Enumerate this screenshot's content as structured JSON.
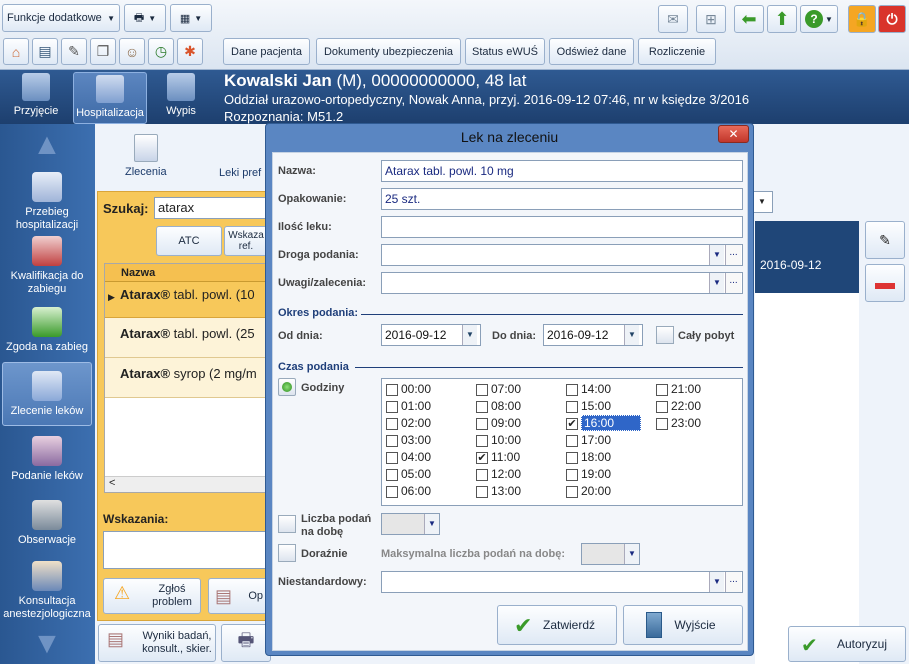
{
  "toolbar": {
    "extra_functions": "Funkcje dodatkowe",
    "buttons": [
      "Dane pacjenta",
      "Dokumenty ubezpieczenia",
      "Status eWUŚ",
      "Odśwież dane",
      "Rozliczenie"
    ]
  },
  "patient": {
    "name": "Kowalski Jan",
    "details": "(M), 00000000000, 48 lat",
    "line2": "Oddział urazowo-ortopedyczny, Nowak Anna, przyj. 2016-09-12 07:46, nr w księdze 3/2016",
    "line3": "Rozpoznania: M51.2"
  },
  "tabs": {
    "admission": "Przyjęcie",
    "hospitalization": "Hospitalizacja",
    "discharge": "Wypis"
  },
  "nav": [
    "Przebieg hospitalizacji",
    "Kwalifikacja do zabiegu",
    "Zgoda na zabieg",
    "Zlecenie leków",
    "Podanie leków",
    "Obserwacje",
    "Konsultacja anestezjologiczna"
  ],
  "content": {
    "orders_label": "Zlecenia",
    "preferred_label": "Leki pref",
    "search_label": "Szukaj:",
    "search_value": "atarax",
    "atc": "ATC",
    "indication_btn": "Wskaza ref.",
    "col_name": "Nazwa",
    "rows": [
      {
        "bold": "Atarax®",
        "rest": " tabl. powl. (10"
      },
      {
        "bold": "Atarax®",
        "rest": " tabl. powl. (25"
      },
      {
        "bold": "Atarax®",
        "rest": " syrop (2 mg/m"
      }
    ],
    "indications_label": "Wskazania:",
    "report_problem": "Zgłoś problem",
    "op_label": "Op",
    "right_date": "2016-09-12",
    "results_btn": "Wyniki badań, konsult., skier.",
    "authorize": "Autoryzuj"
  },
  "dialog": {
    "title": "Lek na zleceniu",
    "name_label": "Nazwa:",
    "name_value": "Atarax tabl. powl. 10 mg",
    "package_label": "Opakowanie:",
    "package_value": "25 szt.",
    "amount_label": "Ilość leku:",
    "route_label": "Droga podania:",
    "notes_label": "Uwagi/zalecenia:",
    "period_label": "Okres podania:",
    "from_label": "Od dnia:",
    "from_value": "2016-09-12",
    "to_label": "Do dnia:",
    "to_value": "2016-09-12",
    "whole_stay": "Cały pobyt",
    "time_label": "Czas podania",
    "hours_label": "Godziny",
    "hours": [
      "00:00",
      "01:00",
      "02:00",
      "03:00",
      "04:00",
      "05:00",
      "06:00",
      "07:00",
      "08:00",
      "09:00",
      "10:00",
      "11:00",
      "12:00",
      "13:00",
      "14:00",
      "15:00",
      "16:00",
      "17:00",
      "18:00",
      "19:00",
      "20:00",
      "21:00",
      "22:00",
      "23:00"
    ],
    "checked_hours": [
      "11:00",
      "16:00"
    ],
    "per_day_label": "Liczba podań na dobę",
    "adhoc_label": "Doraźnie",
    "max_label": "Maksymalna liczba podań na dobę:",
    "nonstandard_label": "Niestandardowy:",
    "confirm": "Zatwierdź",
    "exit": "Wyjście"
  }
}
